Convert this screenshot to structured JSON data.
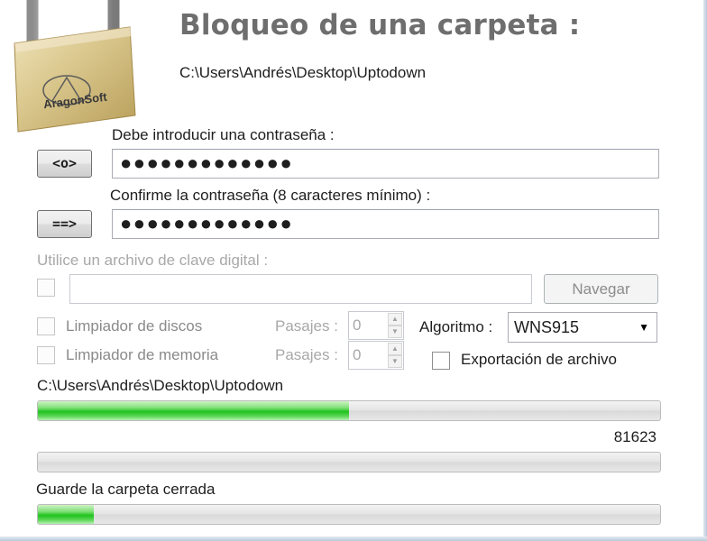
{
  "header": {
    "title": "Bloqueo de una carpeta :",
    "path": "C:\\Users\\Andrés\\Desktop\\Uptodown",
    "logo_text": "AragonSoft"
  },
  "password": {
    "label": "Debe introducir una contraseña :",
    "value": "●●●●●●●●●●●●●",
    "show_button": "<o>"
  },
  "confirm": {
    "label": "Confirme la contraseña (8 caracteres mínimo) :",
    "value": "●●●●●●●●●●●●●",
    "button": "==>"
  },
  "keyfile": {
    "label": "Utilice un archivo de clave digital :",
    "value": "",
    "browse_button": "Navegar"
  },
  "options": {
    "disk_cleaner_label": "Limpiador de discos",
    "memory_cleaner_label": "Limpiador de memoria",
    "passes_label": "Pasajes :",
    "disk_passes": "0",
    "memory_passes": "0",
    "algorithm_label": "Algoritmo :",
    "algorithm_value": "WNS915",
    "export_label": "Exportación de archivo"
  },
  "progress": {
    "path": "C:\\Users\\Andrés\\Desktop\\Uptodown",
    "bar1_fraction": 0.5,
    "counter": "81623",
    "bar2_fraction": 0.0,
    "status": "Guarde la carpeta cerrada",
    "bar3_fraction": 0.09
  },
  "colors": {
    "title": "#6e6e6e",
    "progress_green": "#20c21e",
    "disabled_text": "#a8a8a8"
  }
}
